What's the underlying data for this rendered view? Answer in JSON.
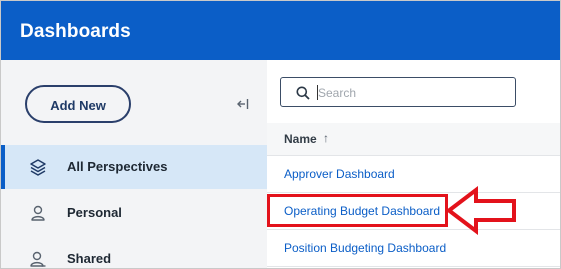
{
  "header": {
    "title": "Dashboards"
  },
  "sidebar": {
    "add_new_label": "Add New",
    "items": [
      {
        "label": "All Perspectives",
        "icon": "layers-icon",
        "active": true
      },
      {
        "label": "Personal",
        "icon": "person-icon",
        "active": false
      },
      {
        "label": "Shared",
        "icon": "shared-users-icon",
        "active": false
      }
    ]
  },
  "main": {
    "search": {
      "placeholder": "Search",
      "value": ""
    },
    "table": {
      "column_name": "Name",
      "sort_indicator": "↑",
      "rows": [
        "Approver Dashboard",
        "Operating Budget Dashboard",
        "Position Budgeting Dashboard"
      ]
    }
  },
  "annotation": {
    "highlighted_row": "Operating Budget Dashboard",
    "color": "#e3121b"
  },
  "colors": {
    "brand": "#0b5ec7",
    "sidebar_bg": "#f3f4f6",
    "active_bg": "#d6e7f7",
    "link": "#0b5ec7"
  }
}
